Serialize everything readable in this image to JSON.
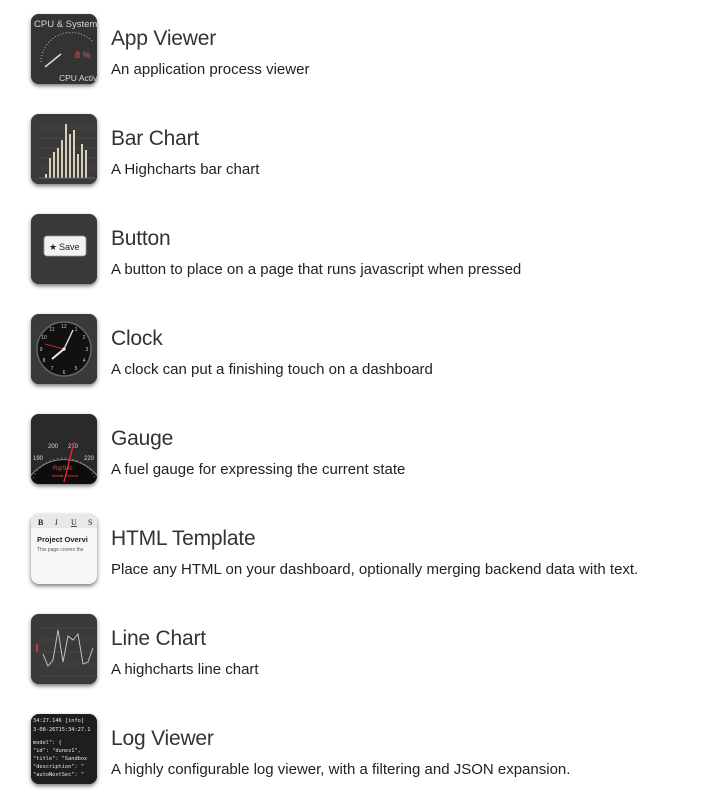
{
  "widgets": [
    {
      "title": "App Viewer",
      "description": "An application process viewer",
      "icon": "app-viewer-thumbnail",
      "thumb": {
        "header": "CPU & System",
        "value": "8 %",
        "footer": "CPU Activity"
      }
    },
    {
      "title": "Bar Chart",
      "description": "A Highcharts bar chart",
      "icon": "bar-chart-thumbnail"
    },
    {
      "title": "Button",
      "description": "A button to place on a page that runs javascript when pressed",
      "icon": "button-thumbnail",
      "thumb": {
        "button_label": "Save"
      }
    },
    {
      "title": "Clock",
      "description": "A clock can put a finishing touch on a dashboard",
      "icon": "clock-thumbnail"
    },
    {
      "title": "Gauge",
      "description": "A fuel gauge for expressing the current state",
      "icon": "gauge-thumbnail",
      "thumb": {
        "ticks": [
          "190",
          "200",
          "210",
          "220"
        ],
        "unit": "Rq/Sec",
        "sub": "Mobile Service"
      }
    },
    {
      "title": "HTML Template",
      "description": "Place any HTML on your dashboard, optionally merging backend data with text.",
      "icon": "html-template-thumbnail",
      "thumb": {
        "toolbar": [
          "B",
          "I",
          "U",
          "S"
        ],
        "heading": "Project Overvi",
        "body": "This page covers the"
      }
    },
    {
      "title": "Line Chart",
      "description": "A highcharts line chart",
      "icon": "line-chart-thumbnail"
    },
    {
      "title": "Log Viewer",
      "description": "A highly configurable log viewer, with a filtering and JSON expansion.",
      "icon": "log-viewer-thumbnail",
      "thumb": {
        "lines": [
          "34:27.146 [info] ",
          "3-08-26T15:34:27.1",
          "model\": {",
          "  \"id\": \"dunes1\",",
          "  \"title\": \"Sandbox",
          "  \"description\": \"",
          "  \"autoNextSec\": \""
        ]
      }
    }
  ]
}
